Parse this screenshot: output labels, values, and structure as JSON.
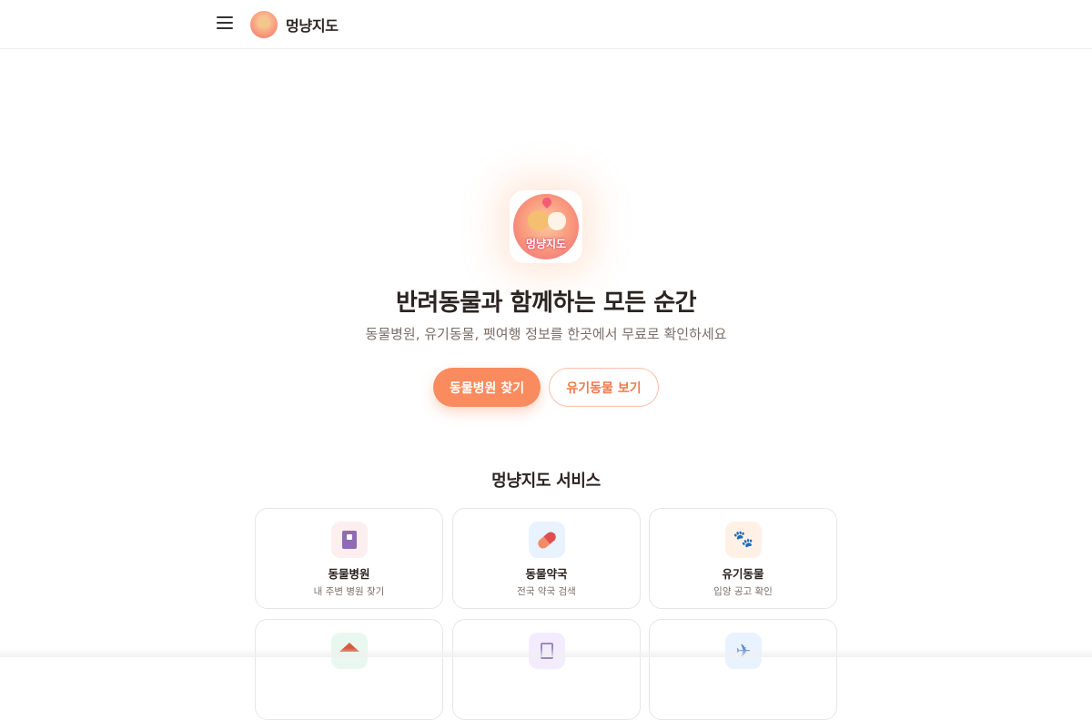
{
  "header": {
    "brand_name": "멍냥지도",
    "menu_icon": "hamburger-menu-icon",
    "logo_icon": "dog-cat-logo"
  },
  "hero": {
    "logo_text": "멍냥지도",
    "title": "반려동물과 함께하는 모든 순간",
    "subtitle": "동물병원, 유기동물, 펫여행 정보를 한곳에서 무료로 확인하세요",
    "primary_button": "동물병원 찾기",
    "secondary_button": "유기동물 보기"
  },
  "services": {
    "title": "멍냥지도 서비스",
    "items": [
      {
        "name": "동물병원",
        "desc": "내 주변 병원 찾기",
        "icon": "hospital-icon"
      },
      {
        "name": "동물약국",
        "desc": "전국 약국 검색",
        "icon": "pill-icon"
      },
      {
        "name": "유기동물",
        "desc": "입양 공고 확인",
        "icon": "paw-icon"
      },
      {
        "name": "",
        "desc": "",
        "icon": "house-icon"
      },
      {
        "name": "",
        "desc": "",
        "icon": "clipboard-icon"
      },
      {
        "name": "",
        "desc": "",
        "icon": "airplane-icon"
      }
    ]
  },
  "colors": {
    "accent": "#f98b5e",
    "outline_border": "#f9c2a9",
    "text_primary": "#2b2420",
    "text_secondary": "#7a6e66"
  }
}
